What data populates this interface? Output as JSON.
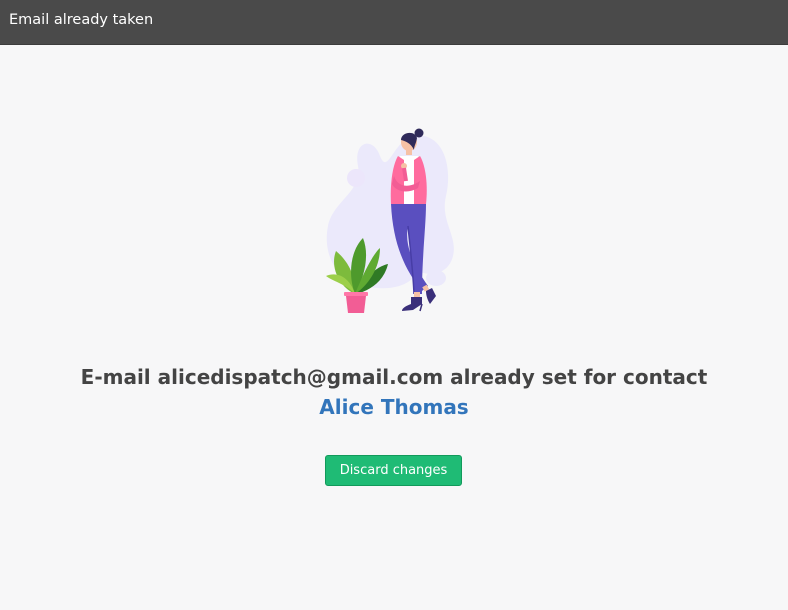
{
  "window": {
    "title": "Email already taken"
  },
  "message": {
    "prefix": "E-mail alicedispatch@gmail.com already set for contact ",
    "contact_name": "Alice Thomas"
  },
  "actions": {
    "discard_label": "Discard changes"
  },
  "colors": {
    "titlebar": "#4a4a4a",
    "background": "#f7f7f8",
    "link": "#3275bb",
    "button": "#1fbb75"
  },
  "illustration": {
    "icon": "woman-with-plant-illustration"
  }
}
